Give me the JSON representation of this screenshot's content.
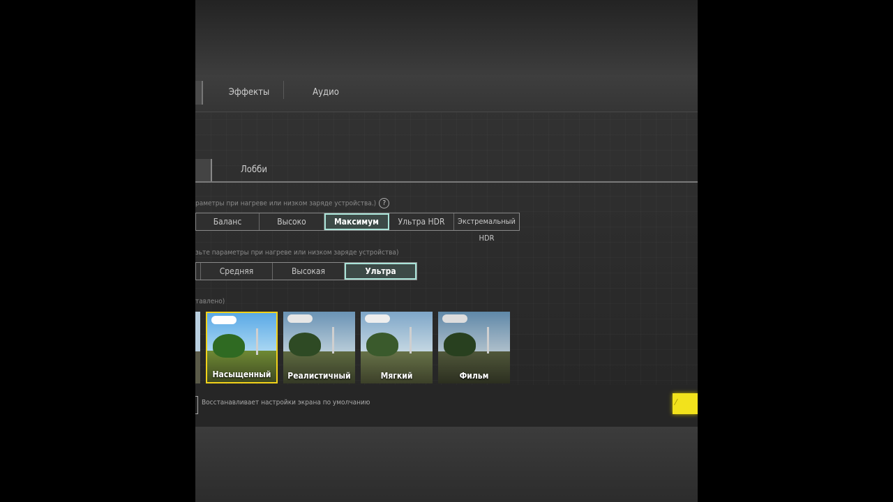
{
  "tabs": {
    "effects": "Эффекты",
    "audio": "Аудио"
  },
  "subtabs": {
    "lobby": "Лобби"
  },
  "graphics": {
    "caption": "раметры при нагреве или низком заряде устройства.)",
    "help_glyph": "?",
    "options": [
      "Баланс",
      "Высоко",
      "Максимум",
      "Ультра HDR",
      "Экстремальный HDR"
    ],
    "selected": "Максимум"
  },
  "framerate": {
    "caption": "зьте параметры при нагреве или низком заряде устройства)",
    "options": [
      "Средняя",
      "Высокая",
      "Ультра"
    ],
    "selected": "Ультра"
  },
  "style": {
    "caption": "тавлено)",
    "filters": [
      "Насыщенный",
      "Реалистичный",
      "Мягкий",
      "Фильм"
    ],
    "selected": "Насыщенный"
  },
  "footer": {
    "reset_text": "Восстанавливает настройки экрана по умолчанию"
  },
  "colors": {
    "accent_yellow": "#f2e21c",
    "selected_outline": "#a9e3d8"
  }
}
